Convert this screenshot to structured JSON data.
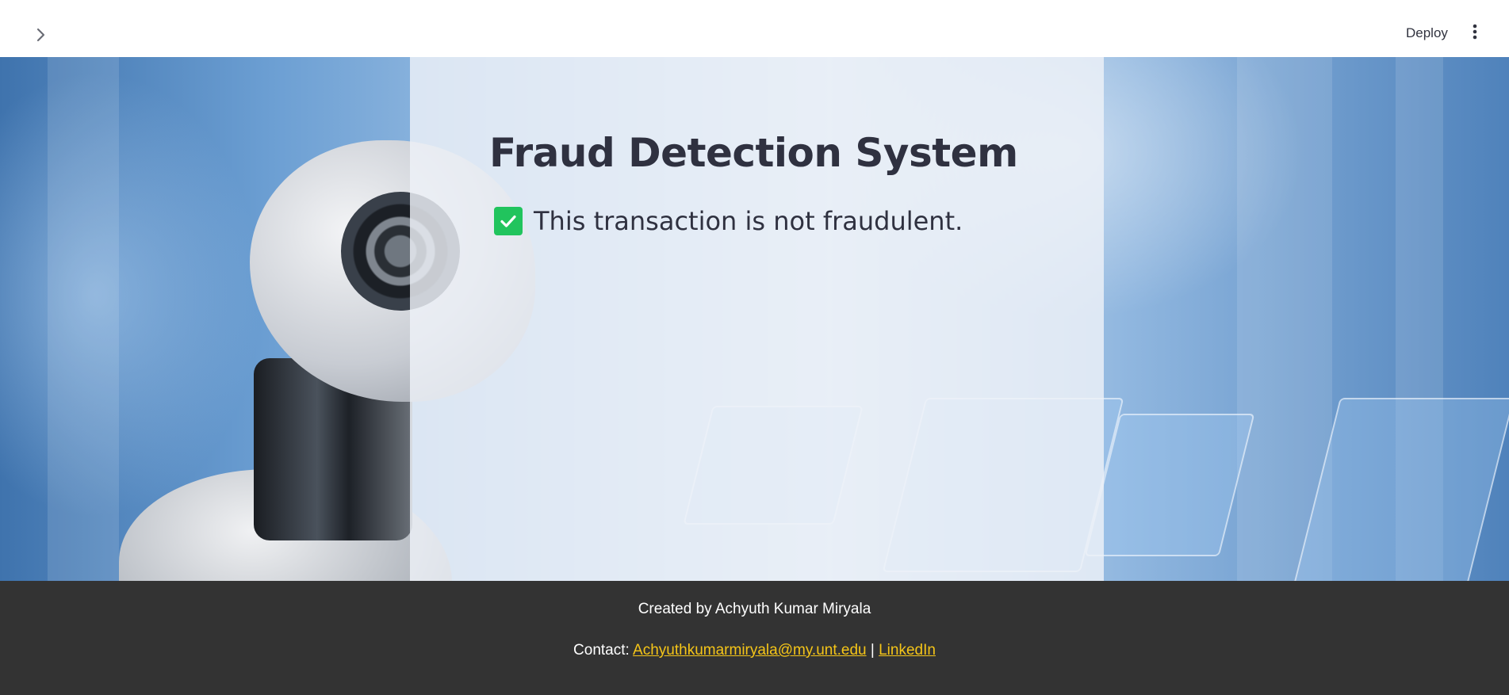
{
  "header": {
    "sidebar_toggle_icon": "chevron-right-icon",
    "deploy_label": "Deploy",
    "menu_icon": "vertical-dots-icon"
  },
  "main": {
    "title": "Fraud Detection System",
    "result_icon": "check-mark-icon",
    "result_text": "This transaction is not fraudulent."
  },
  "footer": {
    "credit": "Created by Achyuth Kumar Miryala",
    "contact_prefix": "Contact:",
    "email": "Achyuthkumarmiryala@my.unt.edu",
    "separator": "|",
    "linkedin": "LinkedIn"
  },
  "colors": {
    "check_green": "#21c45d",
    "link_yellow": "#f5c518",
    "footer_bg": "#333333",
    "title_text": "#2f3140"
  }
}
